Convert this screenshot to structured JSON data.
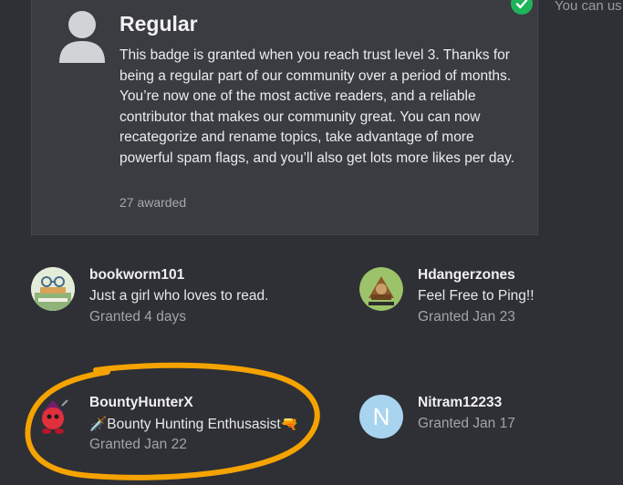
{
  "badge": {
    "title": "Regular",
    "description": "This badge is granted when you reach trust level 3. Thanks for being a regular part of our community over a period of months. You’re now one of the most active readers, and a reliable contributor that makes our community great. You can now recategorize and rename topics, take advantage of more powerful spam flags, and you’ll also get lots more likes per day.",
    "awarded": "27 awarded",
    "icon": "user-icon",
    "granted_check_icon": "check-icon"
  },
  "sidebar": {
    "partial_text": "You can us"
  },
  "granted_users": [
    {
      "username": "bookworm101",
      "bio": "Just a girl who loves to read.",
      "granted": "Granted 4 days"
    },
    {
      "username": "Hdangerzones",
      "bio": "Feel Free to Ping!!",
      "granted": "Granted Jan 23"
    },
    {
      "username": "BountyHunterX",
      "bio": "🗡️Bounty Hunting Enthusasist🔫",
      "granted": "Granted Jan 22"
    },
    {
      "username": "Nitram12233",
      "bio": "",
      "granted": "Granted Jan 17",
      "avatar_letter": "N"
    }
  ],
  "colors": {
    "background": "#2e3035",
    "card": "#3a3c42",
    "check_green": "#1fb35a",
    "highlight_orange": "#f5a300",
    "letter_avatar": "#a9d4ef"
  }
}
